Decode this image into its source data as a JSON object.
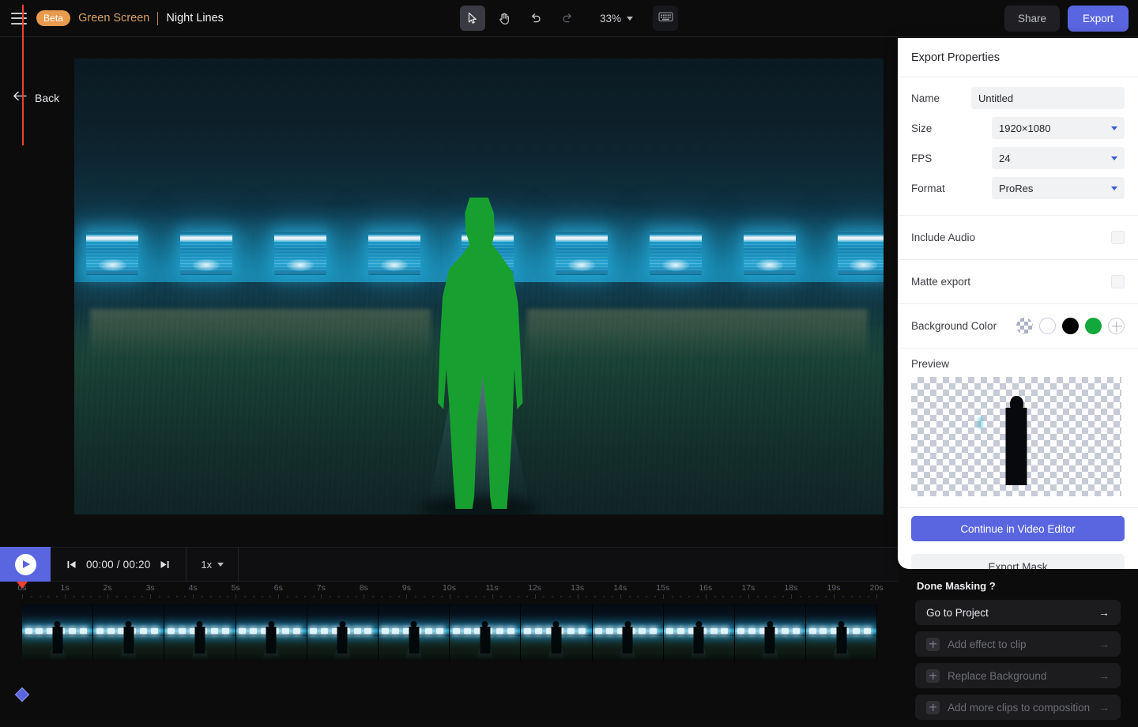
{
  "topbar": {
    "menu_icon": "hamburger-menu-icon",
    "badge": "Beta",
    "project_name": "Green Screen",
    "clip_name": "Night Lines",
    "tools": [
      {
        "name": "select-tool",
        "icon": "cursor-arrow-icon",
        "active": true
      },
      {
        "name": "pan-tool",
        "icon": "hand-icon",
        "active": false
      },
      {
        "name": "undo",
        "icon": "undo-arrow-icon",
        "active": false
      },
      {
        "name": "redo",
        "icon": "redo-arrow-icon",
        "active": false
      }
    ],
    "zoom_level": "33%",
    "keyboard_icon": "keyboard-icon",
    "share_label": "Share",
    "export_label": "Export",
    "accent_color": "#5a65e0",
    "badge_color": "#e89a4e"
  },
  "canvas": {
    "back_label": "Back",
    "back_icon": "arrow-left-icon",
    "silhouette_color": "#17a030",
    "screen_count": 9
  },
  "playback": {
    "play_icon": "play-icon",
    "prev_icon": "skip-previous-icon",
    "next_icon": "skip-next-icon",
    "current_time": "00:00",
    "total_time": "00:20",
    "time_display": "00:00 / 00:20",
    "speed": "1x"
  },
  "timeline": {
    "ticks": [
      "0s",
      "1s",
      "2s",
      "3s",
      "4s",
      "5s",
      "6s",
      "7s",
      "8s",
      "9s",
      "10s",
      "11s",
      "12s",
      "13s",
      "14s",
      "15s",
      "16s",
      "17s",
      "18s",
      "19s",
      "20s"
    ],
    "playhead_time": "0s",
    "playhead_color": "#f0402e",
    "keyframe_color": "#5a65e0",
    "frame_count": 12
  },
  "export_panel": {
    "title": "Export Properties",
    "fields": [
      {
        "label": "Name",
        "value": "Untitled",
        "type": "input",
        "placeholder": "Untitled"
      },
      {
        "label": "Size",
        "value": "1920×1080",
        "type": "select"
      },
      {
        "label": "FPS",
        "value": "24",
        "type": "select"
      },
      {
        "label": "Format",
        "value": "ProRes",
        "type": "select"
      }
    ],
    "toggles": [
      {
        "label": "Include Audio",
        "checked": false
      },
      {
        "label": "Matte export",
        "checked": false
      }
    ],
    "background_color_label": "Background Color",
    "swatches": [
      {
        "name": "transparent",
        "color": "transparent"
      },
      {
        "name": "white",
        "color": "#ffffff"
      },
      {
        "name": "black",
        "color": "#000000"
      },
      {
        "name": "green",
        "color": "#12a83c"
      },
      {
        "name": "add-custom",
        "color": ""
      }
    ],
    "preview_label": "Preview",
    "primary_button": "Continue in Video Editor",
    "secondary_button": "Export Mask"
  },
  "done_masking": {
    "title": "Done Masking ?",
    "items": [
      {
        "label": "Go to Project",
        "has_plus": false,
        "muted": false
      },
      {
        "label": "Add effect to clip",
        "has_plus": true,
        "muted": true
      },
      {
        "label": "Replace Background",
        "has_plus": true,
        "muted": true
      },
      {
        "label": "Add more clips to composition",
        "has_plus": true,
        "muted": true
      }
    ],
    "arrow_icon": "arrow-right-icon"
  }
}
